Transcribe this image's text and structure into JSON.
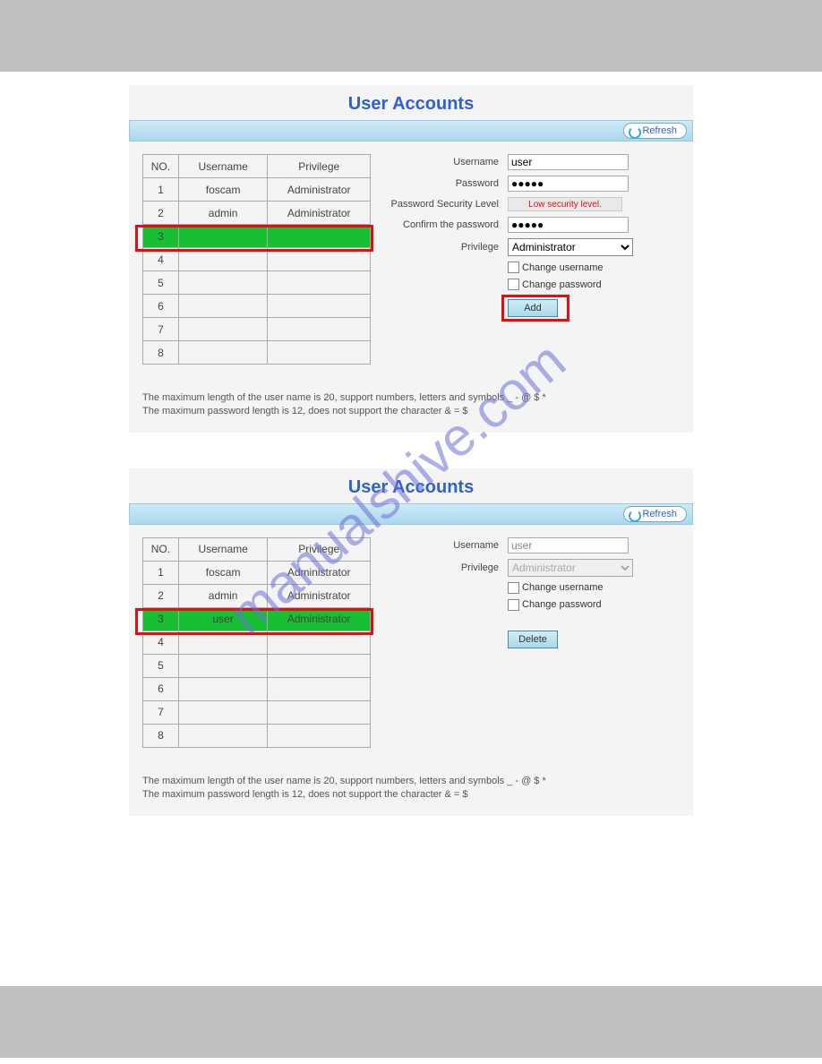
{
  "panel1": {
    "title": "User Accounts",
    "refresh": "Refresh",
    "columns": {
      "no": "NO.",
      "user": "Username",
      "priv": "Privilege"
    },
    "rows": [
      {
        "no": "1",
        "user": "foscam",
        "priv": "Administrator"
      },
      {
        "no": "2",
        "user": "admin",
        "priv": "Administrator"
      },
      {
        "no": "3",
        "user": "",
        "priv": ""
      },
      {
        "no": "4",
        "user": "",
        "priv": ""
      },
      {
        "no": "5",
        "user": "",
        "priv": ""
      },
      {
        "no": "6",
        "user": "",
        "priv": ""
      },
      {
        "no": "7",
        "user": "",
        "priv": ""
      },
      {
        "no": "8",
        "user": "",
        "priv": ""
      }
    ],
    "form": {
      "username_label": "Username",
      "username_value": "user",
      "password_label": "Password",
      "password_value": "●●●●●",
      "psl_label": "Password Security Level",
      "psl_value": "Low security level.",
      "confirm_label": "Confirm the password",
      "confirm_value": "●●●●●",
      "priv_label": "Privilege",
      "priv_value": "Administrator",
      "chg_user": "Change username",
      "chg_pass": "Change password",
      "add": "Add"
    },
    "note1": "The maximum length of the user name is 20, support numbers, letters and symbols _ - @ $ *",
    "note2": "The maximum password length is 12, does not support the character & = $"
  },
  "panel2": {
    "title": "User Accounts",
    "refresh": "Refresh",
    "columns": {
      "no": "NO.",
      "user": "Username",
      "priv": "Privilege"
    },
    "rows": [
      {
        "no": "1",
        "user": "foscam",
        "priv": "Administrator"
      },
      {
        "no": "2",
        "user": "admin",
        "priv": "Administrator"
      },
      {
        "no": "3",
        "user": "user",
        "priv": "Administrator"
      },
      {
        "no": "4",
        "user": "",
        "priv": ""
      },
      {
        "no": "5",
        "user": "",
        "priv": ""
      },
      {
        "no": "6",
        "user": "",
        "priv": ""
      },
      {
        "no": "7",
        "user": "",
        "priv": ""
      },
      {
        "no": "8",
        "user": "",
        "priv": ""
      }
    ],
    "form": {
      "username_label": "Username",
      "username_value": "user",
      "priv_label": "Privilege",
      "priv_value": "Administrator",
      "chg_user": "Change username",
      "chg_pass": "Change password",
      "delete": "Delete"
    },
    "note1": "The maximum length of the user name is 20, support numbers, letters and symbols _ - @ $ *",
    "note2": "The maximum password length is 12, does not support the character & = $"
  },
  "watermark": "manualshive.com"
}
